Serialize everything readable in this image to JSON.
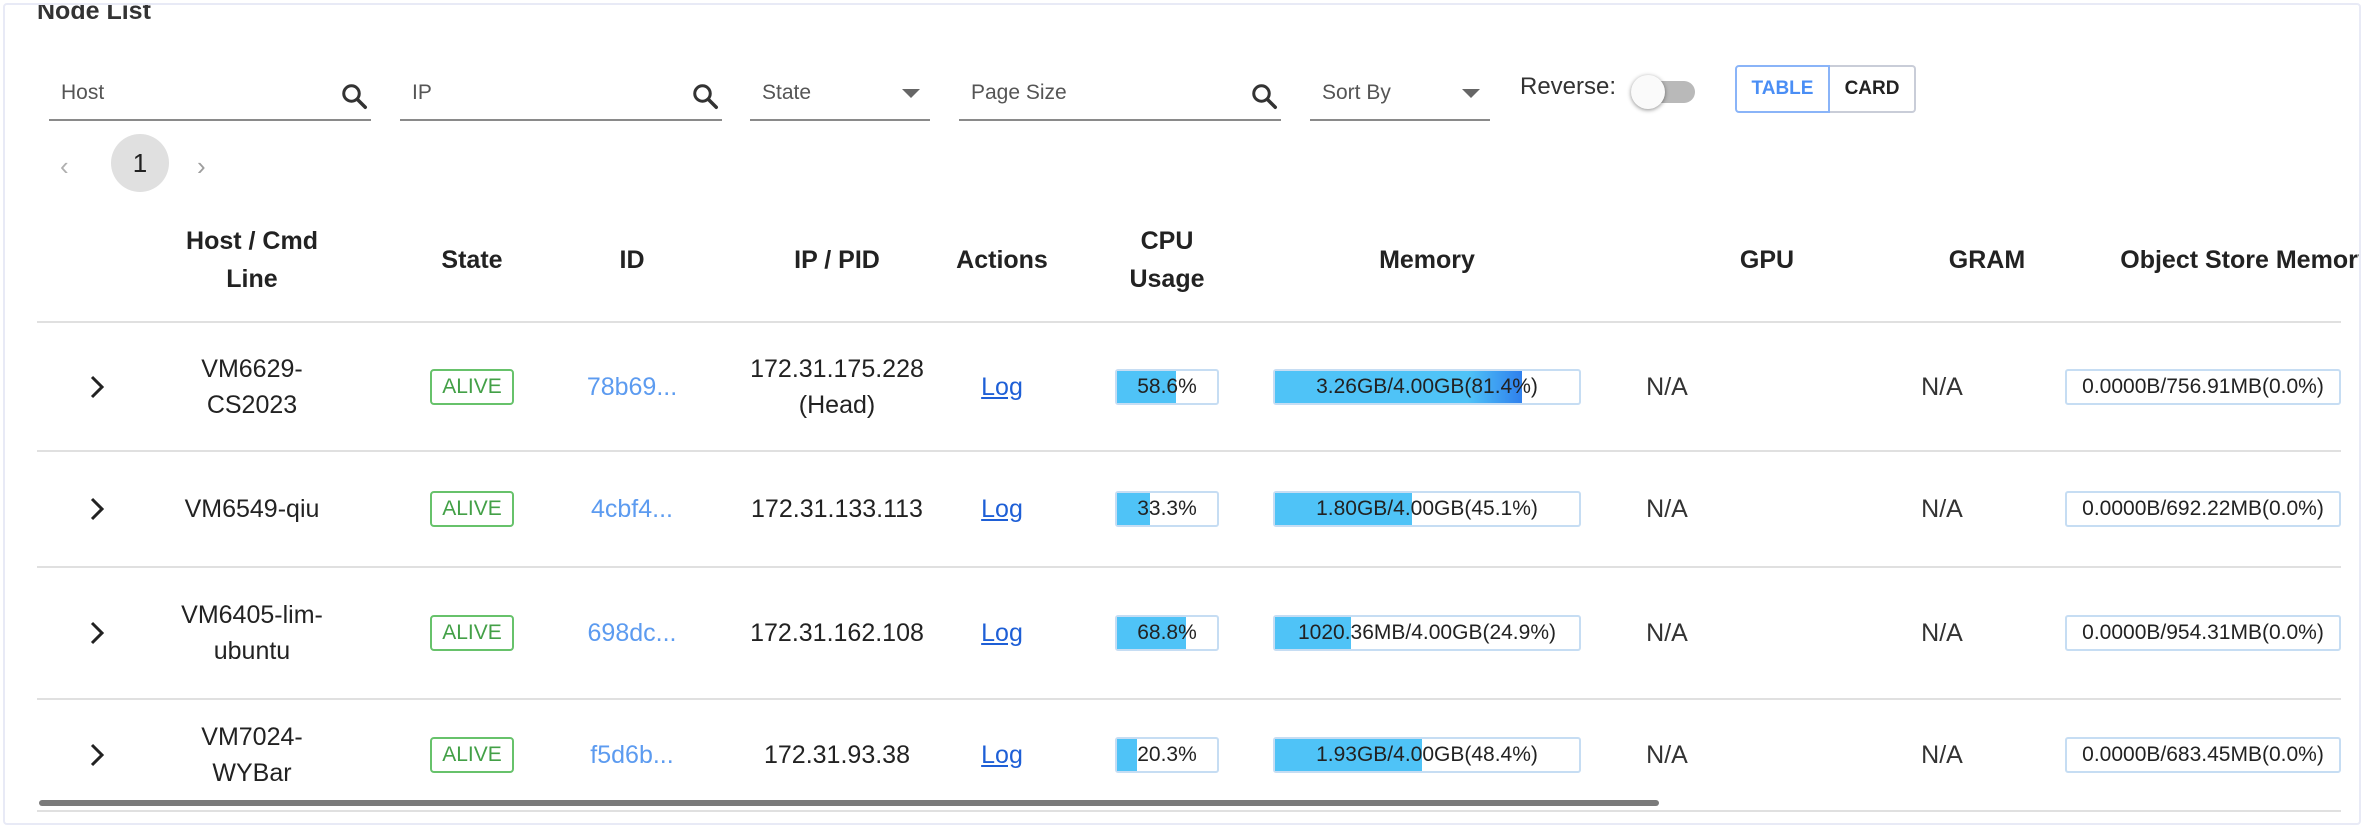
{
  "title": "Node List",
  "filters": {
    "host": "Host",
    "ip": "IP",
    "state": "State",
    "page_size": "Page Size",
    "sort_by": "Sort By",
    "reverse_label": "Reverse:",
    "reverse_on": false,
    "view_table": "TABLE",
    "view_card": "CARD"
  },
  "pagination": {
    "current": "1",
    "prev": "‹",
    "next": "›"
  },
  "columns": [
    "Host / Cmd\nLine",
    "State",
    "ID",
    "IP / PID",
    "Actions",
    "CPU\nUsage",
    "Memory",
    "GPU",
    "GRAM",
    "Object Store Memory"
  ],
  "rows": [
    {
      "host": "VM6629-\nCS2023",
      "state": "ALIVE",
      "id": "78b69...",
      "ip": "172.31.175.228\n(Head)",
      "action": "Log",
      "cpu_label": "58.6%",
      "cpu_pct": 58.6,
      "mem_label": "3.26GB/4.00GB(81.4%)",
      "mem_pct": 81.4,
      "gpu": "N/A",
      "gram": "N/A",
      "obj_label": "0.0000B/756.91MB(0.0%)",
      "obj_pct": 0
    },
    {
      "host": "VM6549-qiu",
      "state": "ALIVE",
      "id": "4cbf4...",
      "ip": "172.31.133.113",
      "action": "Log",
      "cpu_label": "33.3%",
      "cpu_pct": 33.3,
      "mem_label": "1.80GB/4.00GB(45.1%)",
      "mem_pct": 45.1,
      "gpu": "N/A",
      "gram": "N/A",
      "obj_label": "0.0000B/692.22MB(0.0%)",
      "obj_pct": 0
    },
    {
      "host": "VM6405-lim-\nubuntu",
      "state": "ALIVE",
      "id": "698dc...",
      "ip": "172.31.162.108",
      "action": "Log",
      "cpu_label": "68.8%",
      "cpu_pct": 68.8,
      "mem_label": "1020.36MB/4.00GB(24.9%)",
      "mem_pct": 24.9,
      "gpu": "N/A",
      "gram": "N/A",
      "obj_label": "0.0000B/954.31MB(0.0%)",
      "obj_pct": 0
    },
    {
      "host": "VM7024-WYBar",
      "state": "ALIVE",
      "id": "f5d6b...",
      "ip": "172.31.93.38",
      "action": "Log",
      "cpu_label": "20.3%",
      "cpu_pct": 20.3,
      "mem_label": "1.93GB/4.00GB(48.4%)",
      "mem_pct": 48.4,
      "gpu": "N/A",
      "gram": "N/A",
      "obj_label": "0.0000B/683.45MB(0.0%)",
      "obj_pct": 0
    }
  ],
  "icons": {
    "search": "search-icon",
    "dropdown": "chevron-down-icon",
    "expand": "chevron-right-icon"
  },
  "colors": {
    "accent": "#4a8ef5",
    "alive": "#43a047",
    "bar_fill": "#4fc3f7",
    "link": "#1e5fd6"
  }
}
